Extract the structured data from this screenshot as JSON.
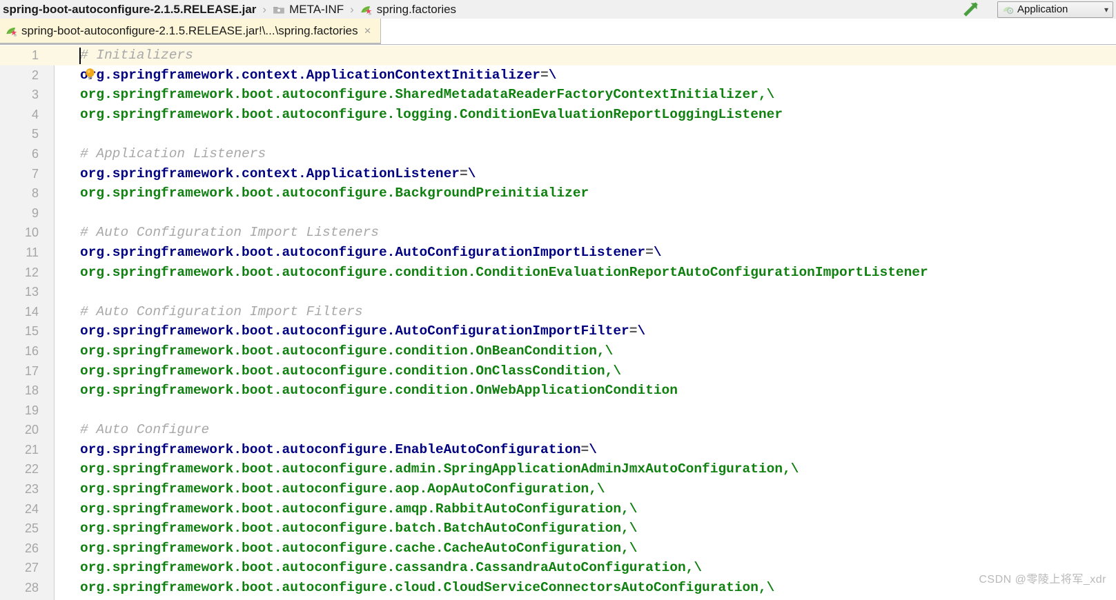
{
  "breadcrumb": {
    "items": [
      {
        "label": "spring-boot-autoconfigure-2.1.5.RELEASE.jar",
        "icon": "none",
        "bold": true
      },
      {
        "label": "META-INF",
        "icon": "folder-icon",
        "bold": false
      },
      {
        "label": "spring.factories",
        "icon": "spring-leaf-icon",
        "bold": false
      }
    ],
    "separator": "›"
  },
  "toolbar": {
    "build_icon": "build-arrow-icon",
    "run_config": {
      "icon": "run-configuration-icon",
      "label": "Application",
      "caret": "⌄"
    }
  },
  "tab": {
    "icon": "spring-leaf-icon",
    "label": "spring-boot-autoconfigure-2.1.5.RELEASE.jar!\\...\\spring.factories",
    "close": "×"
  },
  "editor": {
    "current_line": 1,
    "colors": {
      "comment": "#a8a8a8",
      "key": "#000080",
      "value": "#108010",
      "equals": "#555555",
      "gutter_bg": "#f2f2f2",
      "current_line_bg": "#fdf8e3",
      "line_number": "#a6a6a6"
    },
    "lines": [
      {
        "n": 1,
        "parts": [
          {
            "t": "cmt",
            "s": "# Initializers"
          }
        ]
      },
      {
        "n": 2,
        "parts": [
          {
            "t": "key",
            "s": "org.springframework.context.ApplicationContextInitializer"
          },
          {
            "t": "eq",
            "s": "="
          },
          {
            "t": "bs",
            "s": "\\"
          }
        ]
      },
      {
        "n": 3,
        "parts": [
          {
            "t": "val",
            "s": "org.springframework.boot.autoconfigure.SharedMetadataReaderFactoryContextInitializer,\\"
          }
        ]
      },
      {
        "n": 4,
        "parts": [
          {
            "t": "val",
            "s": "org.springframework.boot.autoconfigure.logging.ConditionEvaluationReportLoggingListener"
          }
        ]
      },
      {
        "n": 5,
        "parts": []
      },
      {
        "n": 6,
        "parts": [
          {
            "t": "cmt",
            "s": "# Application Listeners"
          }
        ]
      },
      {
        "n": 7,
        "parts": [
          {
            "t": "key",
            "s": "org.springframework.context.ApplicationListener"
          },
          {
            "t": "eq",
            "s": "="
          },
          {
            "t": "bs",
            "s": "\\"
          }
        ]
      },
      {
        "n": 8,
        "parts": [
          {
            "t": "val",
            "s": "org.springframework.boot.autoconfigure.BackgroundPreinitializer"
          }
        ]
      },
      {
        "n": 9,
        "parts": []
      },
      {
        "n": 10,
        "parts": [
          {
            "t": "cmt",
            "s": "# Auto Configuration Import Listeners"
          }
        ]
      },
      {
        "n": 11,
        "parts": [
          {
            "t": "key",
            "s": "org.springframework.boot.autoconfigure.AutoConfigurationImportListener"
          },
          {
            "t": "eq",
            "s": "="
          },
          {
            "t": "bs",
            "s": "\\"
          }
        ]
      },
      {
        "n": 12,
        "parts": [
          {
            "t": "val",
            "s": "org.springframework.boot.autoconfigure.condition.ConditionEvaluationReportAutoConfigurationImportListener"
          }
        ]
      },
      {
        "n": 13,
        "parts": []
      },
      {
        "n": 14,
        "parts": [
          {
            "t": "cmt",
            "s": "# Auto Configuration Import Filters"
          }
        ]
      },
      {
        "n": 15,
        "parts": [
          {
            "t": "key",
            "s": "org.springframework.boot.autoconfigure.AutoConfigurationImportFilter"
          },
          {
            "t": "eq",
            "s": "="
          },
          {
            "t": "bs",
            "s": "\\"
          }
        ]
      },
      {
        "n": 16,
        "parts": [
          {
            "t": "val",
            "s": "org.springframework.boot.autoconfigure.condition.OnBeanCondition,\\"
          }
        ]
      },
      {
        "n": 17,
        "parts": [
          {
            "t": "val",
            "s": "org.springframework.boot.autoconfigure.condition.OnClassCondition,\\"
          }
        ]
      },
      {
        "n": 18,
        "parts": [
          {
            "t": "val",
            "s": "org.springframework.boot.autoconfigure.condition.OnWebApplicationCondition"
          }
        ]
      },
      {
        "n": 19,
        "parts": []
      },
      {
        "n": 20,
        "parts": [
          {
            "t": "cmt",
            "s": "# Auto Configure"
          }
        ]
      },
      {
        "n": 21,
        "parts": [
          {
            "t": "key",
            "s": "org.springframework.boot.autoconfigure.EnableAutoConfiguration"
          },
          {
            "t": "eq",
            "s": "="
          },
          {
            "t": "bs",
            "s": "\\"
          }
        ]
      },
      {
        "n": 22,
        "parts": [
          {
            "t": "val",
            "s": "org.springframework.boot.autoconfigure.admin.SpringApplicationAdminJmxAutoConfiguration,\\"
          }
        ]
      },
      {
        "n": 23,
        "parts": [
          {
            "t": "val",
            "s": "org.springframework.boot.autoconfigure.aop.AopAutoConfiguration,\\"
          }
        ]
      },
      {
        "n": 24,
        "parts": [
          {
            "t": "val",
            "s": "org.springframework.boot.autoconfigure.amqp.RabbitAutoConfiguration,\\"
          }
        ]
      },
      {
        "n": 25,
        "parts": [
          {
            "t": "val",
            "s": "org.springframework.boot.autoconfigure.batch.BatchAutoConfiguration,\\"
          }
        ]
      },
      {
        "n": 26,
        "parts": [
          {
            "t": "val",
            "s": "org.springframework.boot.autoconfigure.cache.CacheAutoConfiguration,\\"
          }
        ]
      },
      {
        "n": 27,
        "parts": [
          {
            "t": "val",
            "s": "org.springframework.boot.autoconfigure.cassandra.CassandraAutoConfiguration,\\"
          }
        ]
      },
      {
        "n": 28,
        "parts": [
          {
            "t": "val",
            "s": "org.springframework.boot.autoconfigure.cloud.CloudServiceConnectorsAutoConfiguration,\\"
          }
        ]
      }
    ]
  },
  "watermark": "CSDN @零陵上将军_xdr"
}
